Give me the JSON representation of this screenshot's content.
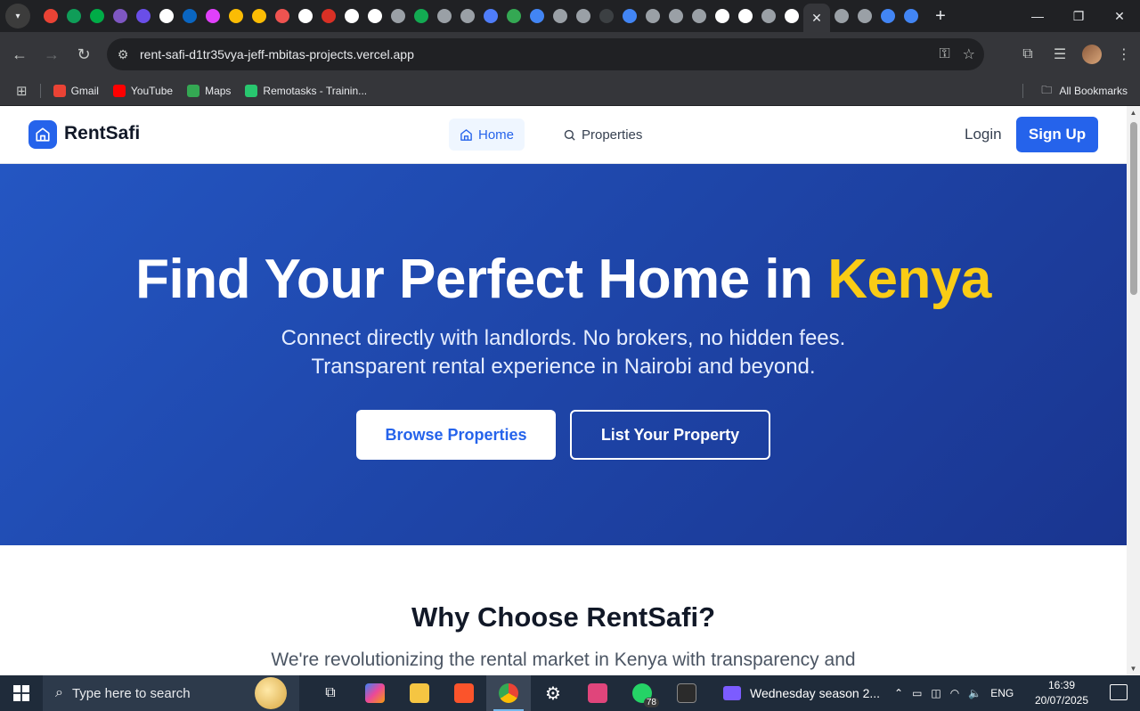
{
  "browser": {
    "url": "rent-safi-d1tr35vya-jeff-mbitas-projects.vercel.app",
    "close_tab": "✕",
    "new_tab": "+",
    "bookmarks": [
      {
        "label": "Gmail",
        "color": "#ea4335"
      },
      {
        "label": "YouTube",
        "color": "#ff0000"
      },
      {
        "label": "Maps",
        "color": "#34a853"
      },
      {
        "label": "Remotasks - Trainin...",
        "color": "#28c76f"
      }
    ],
    "all_bookmarks": "All Bookmarks",
    "tab_favicons": [
      "#ea4335",
      "#0f9d58",
      "#00ac47",
      "#7e57c2",
      "#6a4ee8",
      "#ffffff",
      "#0a66c2",
      "#e040fb",
      "#fbbc04",
      "#fbbc04",
      "#ef5350",
      "#ffffff",
      "#d93025",
      "#ffffff",
      "#ffffff",
      "#9aa0a6",
      "#13aa52",
      "#9aa0a6",
      "#9aa0a6",
      "#4f7df9",
      "#34a853",
      "#4285f4",
      "#9aa0a6",
      "#9aa0a6",
      "#3c4043",
      "#4285f4",
      "#9aa0a6",
      "#9aa0a6",
      "#9aa0a6",
      "#ffffff",
      "#ffffff",
      "#9aa0a6",
      "#ffffff"
    ]
  },
  "site": {
    "brand": "RentSafi",
    "nav": {
      "home": "Home",
      "properties": "Properties",
      "login": "Login",
      "signup": "Sign Up"
    },
    "hero": {
      "title_main": "Find Your Perfect Home in ",
      "title_accent": "Kenya",
      "subtitle_line1": "Connect directly with landlords. No brokers, no hidden fees.",
      "subtitle_line2": "Transparent rental experience in Nairobi and beyond.",
      "browse_button": "Browse Properties",
      "list_button": "List Your Property"
    },
    "why": {
      "title": "Why Choose RentSafi?",
      "subtitle": "We're revolutionizing the rental market in Kenya with transparency and"
    },
    "colors": {
      "primary": "#2563eb",
      "accent": "#facc15",
      "hero_bg": "#1e45a8"
    }
  },
  "taskbar": {
    "search_placeholder": "Type here to search",
    "whatsapp_badge": "78",
    "media_title": "Wednesday season 2...",
    "language": "ENG",
    "time": "16:39",
    "date": "20/07/2025"
  }
}
